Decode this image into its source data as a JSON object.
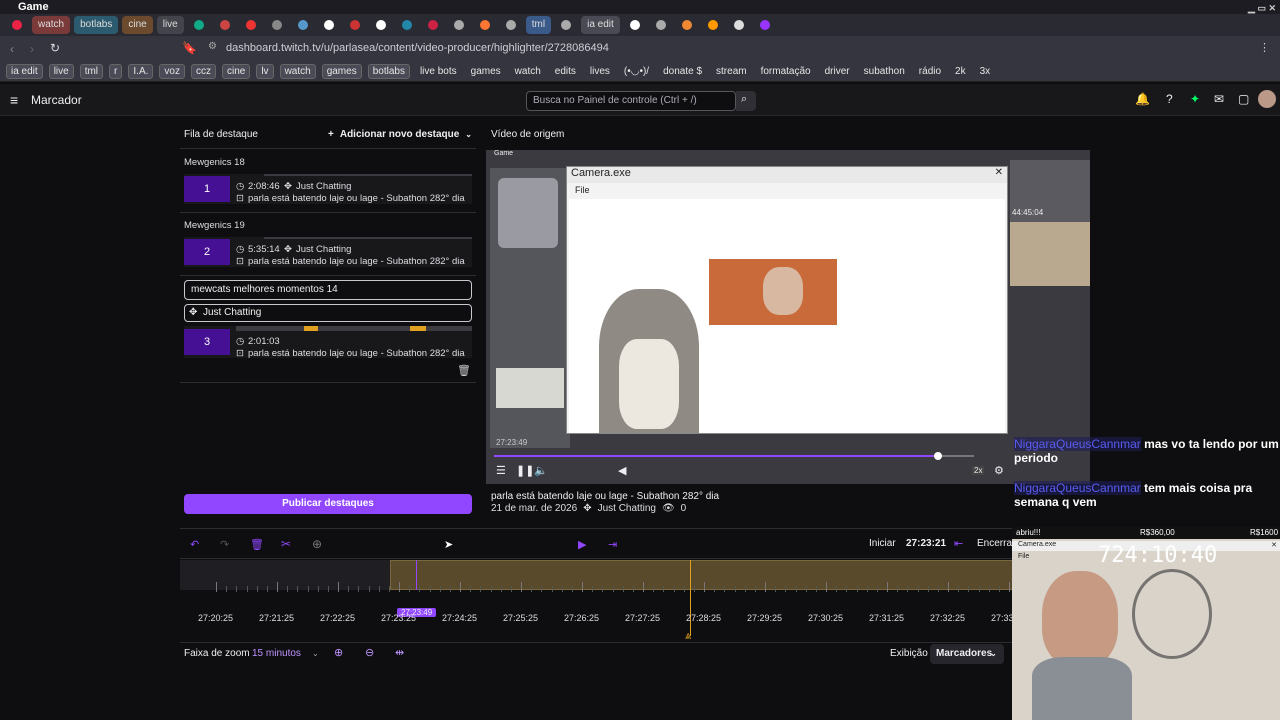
{
  "window": {
    "title": "Game"
  },
  "tabs": [
    {
      "label": "",
      "color": "#e24"
    },
    {
      "label": "watch",
      "color": "#7a3a3a"
    },
    {
      "label": "botlabs",
      "color": "#2c5a6e"
    },
    {
      "label": "cine",
      "color": "#6b4a2e"
    },
    {
      "label": "live",
      "color": "#44444c"
    },
    {
      "label": "",
      "color": "#1a8"
    },
    {
      "label": "",
      "color": "#c44"
    },
    {
      "label": "",
      "color": "#e33"
    },
    {
      "label": "",
      "color": "#888"
    },
    {
      "label": "",
      "color": "#59c"
    },
    {
      "label": "",
      "color": "#fff"
    },
    {
      "label": "",
      "color": "#c33"
    },
    {
      "label": "",
      "color": "#fff"
    },
    {
      "label": "",
      "color": "#28a"
    },
    {
      "label": "",
      "color": "#c24"
    },
    {
      "label": "",
      "color": "#aaa"
    },
    {
      "label": "",
      "color": "#f73"
    },
    {
      "label": "",
      "color": "#aaa"
    },
    {
      "label": "tml",
      "color": "#3a5a8a"
    },
    {
      "label": "",
      "color": "#aaa"
    },
    {
      "label": "ia edit",
      "color": "#4a4a55"
    },
    {
      "label": "",
      "color": "#fff"
    },
    {
      "label": "",
      "color": "#aaa"
    },
    {
      "label": "",
      "color": "#e83"
    },
    {
      "label": "",
      "color": "#f90"
    },
    {
      "label": "",
      "color": "#ddd"
    },
    {
      "label": "",
      "color": "#93f"
    }
  ],
  "address": {
    "url": "dashboard.twitch.tv/u/parlasea/content/video-producer/highlighter/2728086494"
  },
  "bookmarks": [
    {
      "label": "ia edit",
      "chip": true
    },
    {
      "label": "live",
      "chip": true
    },
    {
      "label": "tml",
      "chip": true
    },
    {
      "label": "r",
      "chip": true
    },
    {
      "label": "I.A.",
      "chip": true
    },
    {
      "label": "voz",
      "chip": true
    },
    {
      "label": "ccz",
      "chip": true
    },
    {
      "label": "cine",
      "chip": true
    },
    {
      "label": "lv",
      "chip": true
    },
    {
      "label": "watch",
      "chip": true
    },
    {
      "label": "games",
      "chip": true
    },
    {
      "label": "botlabs",
      "chip": true
    },
    {
      "label": "live bots",
      "chip": false
    },
    {
      "label": "games",
      "chip": false
    },
    {
      "label": "watch",
      "chip": false
    },
    {
      "label": "edits",
      "chip": false
    },
    {
      "label": "lives",
      "chip": false
    },
    {
      "label": "(•◡•)/",
      "chip": false
    },
    {
      "label": "donate $",
      "chip": false
    },
    {
      "label": "stream",
      "chip": false
    },
    {
      "label": "formatação",
      "chip": false
    },
    {
      "label": "driver",
      "chip": false
    },
    {
      "label": "subathon",
      "chip": false
    },
    {
      "label": "rádio",
      "chip": false
    },
    {
      "label": "2k",
      "chip": false
    },
    {
      "label": "3x",
      "chip": false
    }
  ],
  "header": {
    "title": "Marcador",
    "search_placeholder": "Busca no Painel de controle (Ctrl + /)"
  },
  "queue": {
    "title": "Fila de destaque",
    "add_label": "Adicionar novo destaque",
    "items": [
      {
        "group": "Mewgenics 18",
        "num": "1",
        "duration": "2:08:46",
        "category": "Just Chatting",
        "title": "parla está batendo laje ou lage - Subathon 282° dia"
      },
      {
        "group": "Mewgenics 19",
        "num": "2",
        "duration": "5:35:14",
        "category": "Just Chatting",
        "title": "parla está batendo laje ou lage - Subathon 282° dia"
      }
    ],
    "editing": {
      "title_value": "mewcats melhores momentos 14",
      "category_value": "Just Chatting",
      "num": "3",
      "duration": "2:01:03",
      "title": "parla está batendo laje ou lage - Subathon 282° dia"
    },
    "publish_label": "Publicar destaques"
  },
  "source": {
    "title": "Vídeo de origem",
    "overlay_title": "Game",
    "camera_window": "Camera.exe",
    "camera_menu": "File",
    "side_counter": "44:45:04",
    "time_overlay": "27:23:49",
    "rate": "2x",
    "stream_title": "parla está batendo laje ou lage - Subathon 282° dia",
    "date": "21 de mar. de 2026",
    "category": "Just Chatting",
    "views": "0"
  },
  "timeline": {
    "start_label": "Iniciar",
    "start_time": "27:23:21",
    "end_label": "Encerrar",
    "cursor_time": "27:23:49",
    "ticks": [
      "27:20:25",
      "27:21:25",
      "27:22:25",
      "27:23:25",
      "27:24:25",
      "27:25:25",
      "27:26:25",
      "27:27:25",
      "27:28:25",
      "27:29:25",
      "27:30:25",
      "27:31:25",
      "27:32:25",
      "27:33:25"
    ],
    "zoom_label": "Faixa de zoom",
    "zoom_value": "15 minutos",
    "display_label": "Exibição",
    "display_value": "Marcadores"
  },
  "chat": [
    {
      "user": "NiggaraQueusCannmar",
      "msg": "mas vo ta lendo por um periodo"
    },
    {
      "user": "NiggaraQueusCannmar",
      "msg": "tem mais coisa pra semana q vem"
    }
  ],
  "webcam": {
    "banner_left": "abriu!!!",
    "banner_mid": "R$360,00",
    "banner_right": "R$1600",
    "window": "Camera.exe",
    "menu": "File",
    "counter": "724:10:40"
  },
  "colors": {
    "accent": "#9147ff",
    "marker": "#e0a020",
    "highlight_bar": "#5a4a2c"
  }
}
